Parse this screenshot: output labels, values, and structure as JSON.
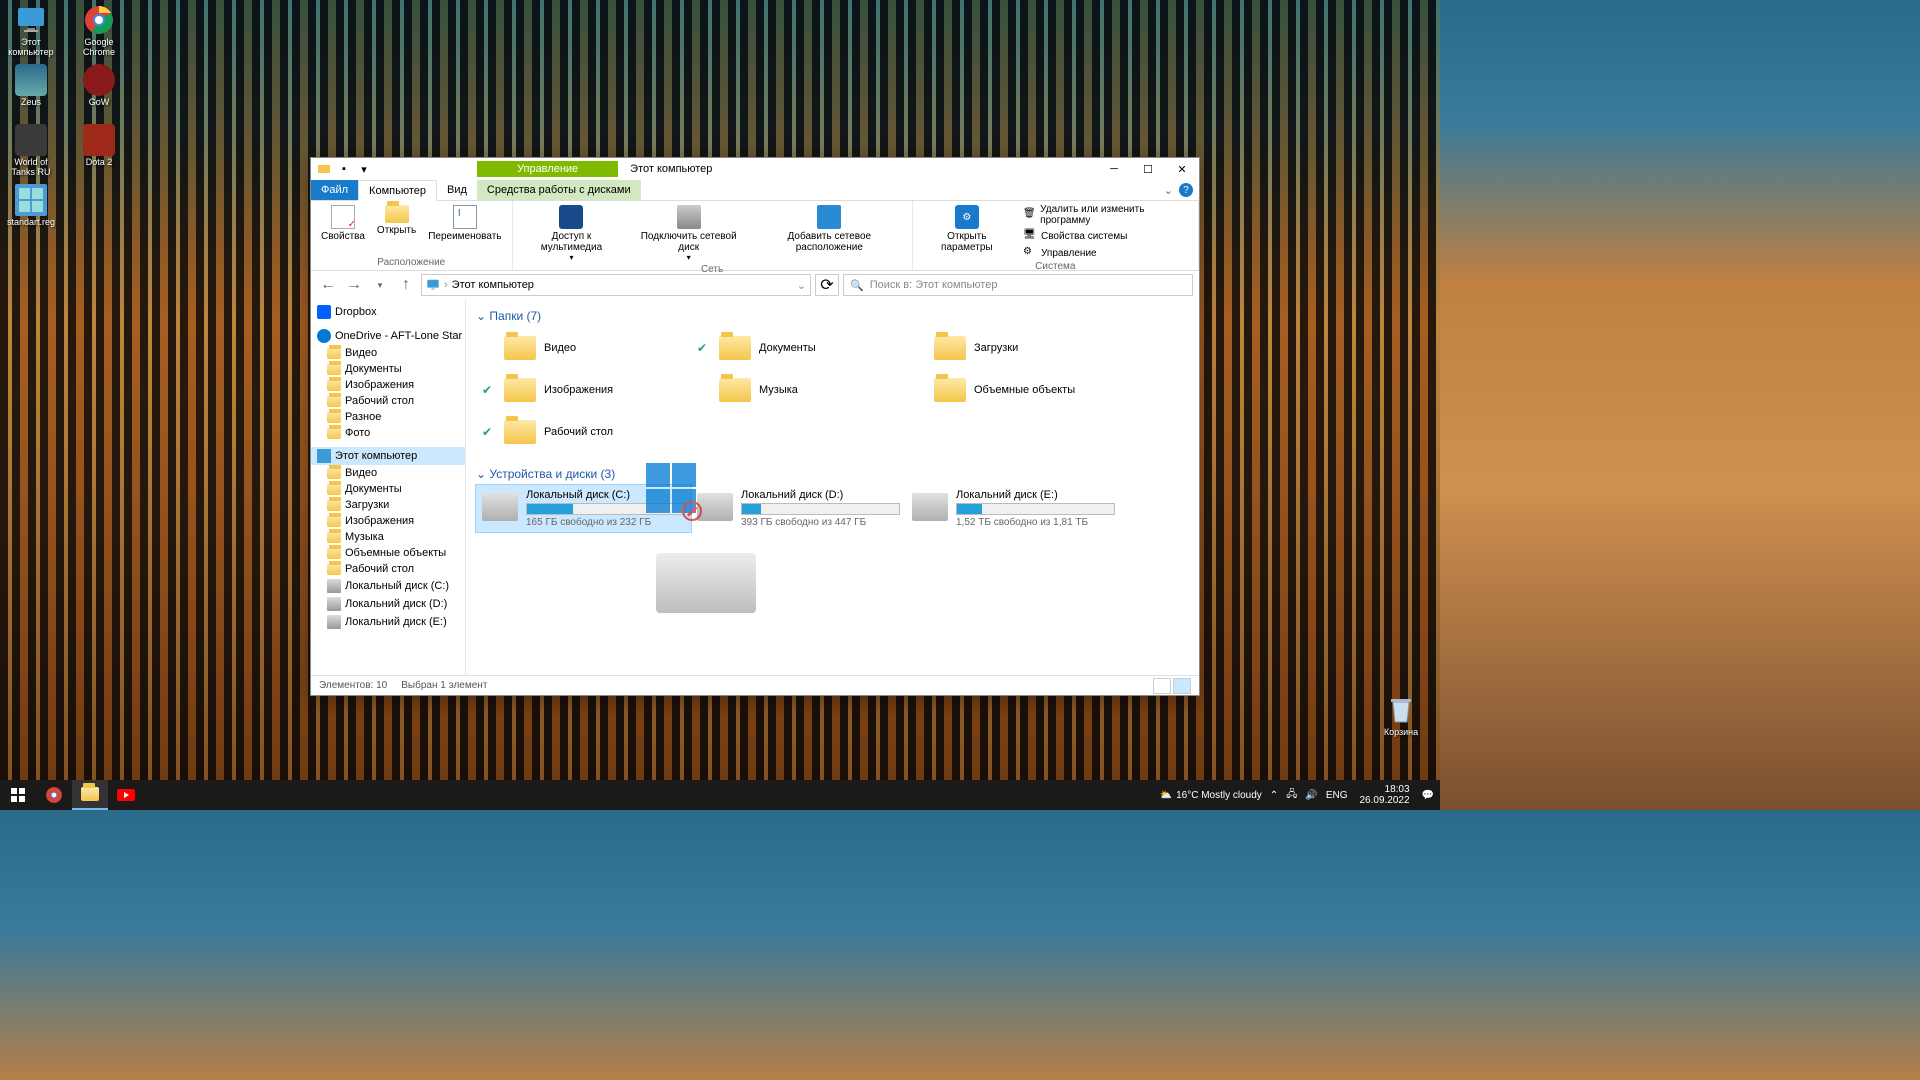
{
  "desktop": {
    "icons_left": [
      {
        "label": "Этот компьютер",
        "name": "this-pc-icon"
      },
      {
        "label": "Zeus",
        "name": "zeus-icon"
      },
      {
        "label": "World of Tanks RU",
        "name": "wot-icon"
      },
      {
        "label": "standart.reg",
        "name": "regfile-icon"
      }
    ],
    "icons_col2": [
      {
        "label": "Google Chrome",
        "name": "chrome-icon"
      },
      {
        "label": "GoW",
        "name": "gow-icon"
      },
      {
        "label": "Dota 2",
        "name": "dota-icon"
      }
    ],
    "trash": "Корзина"
  },
  "explorer": {
    "context_tab": "Управление",
    "title": "Этот компьютер",
    "tabs": {
      "file": "Файл",
      "computer": "Компьютер",
      "view": "Вид",
      "drive_tools": "Средства работы с дисками"
    },
    "ribbon": {
      "location": {
        "name": "Расположение",
        "properties": "Свойства",
        "open": "Открыть",
        "rename": "Переименовать"
      },
      "network": {
        "name": "Сеть",
        "media": "Доступ к мультимедиа",
        "map_drive": "Подключить сетевой диск",
        "add_location": "Добавить сетевое расположение"
      },
      "system": {
        "name": "Система",
        "open_settings": "Открыть параметры",
        "uninstall": "Удалить или изменить программу",
        "sys_props": "Свойства системы",
        "manage": "Управление"
      }
    },
    "address": {
      "location": "Этот компьютер"
    },
    "search_placeholder": "Поиск в: Этот компьютер",
    "nav": {
      "dropbox": "Dropbox",
      "onedrive": "OneDrive - AFT-Lone Star Colle",
      "od_children": [
        "Видео",
        "Документы",
        "Изображения",
        "Рабочий стол",
        "Разное",
        "Фото"
      ],
      "this_pc": "Этот компьютер",
      "pc_children": [
        "Видео",
        "Документы",
        "Загрузки",
        "Изображения",
        "Музыка",
        "Объемные объекты",
        "Рабочий стол",
        "Локальный диск (C:)",
        "Локальний диск (D:)",
        "Локальний диск (E:)"
      ]
    },
    "sections": {
      "folders": {
        "header": "Папки (7)",
        "items": [
          "Видео",
          "Документы",
          "Загрузки",
          "Изображения",
          "Музыка",
          "Объемные объекты",
          "Рабочий стол"
        ]
      },
      "drives": {
        "header": "Устройства и диски (3)",
        "items": [
          {
            "name": "Локальный диск (C:)",
            "free": "165 ГБ свободно из 232 ГБ",
            "fill": 29
          },
          {
            "name": "Локальний диск (D:)",
            "free": "393 ГБ свободно из 447 ГБ",
            "fill": 12
          },
          {
            "name": "Локальний диск (E:)",
            "free": "1,52 ТБ свободно из 1,81 ТБ",
            "fill": 16
          }
        ]
      }
    },
    "status": {
      "count": "Элементов: 10",
      "selected": "Выбран 1 элемент"
    }
  },
  "taskbar": {
    "weather": "16°C  Mostly cloudy",
    "lang": "ENG",
    "time": "18:03",
    "date": "26.09.2022"
  }
}
